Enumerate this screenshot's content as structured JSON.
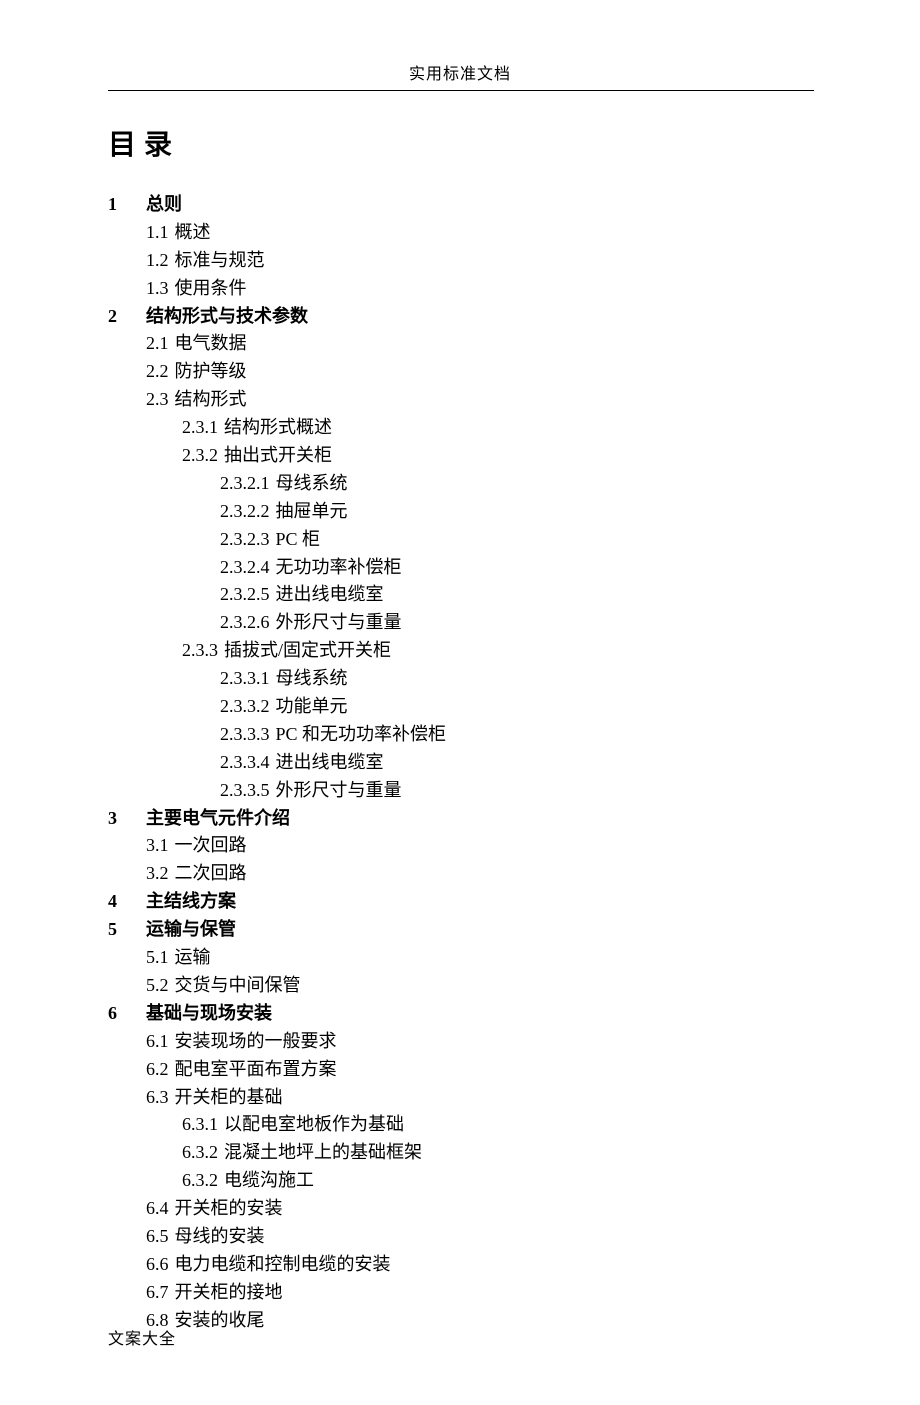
{
  "header": "实用标准文档",
  "footer": "文案大全",
  "title": "目录",
  "toc": [
    {
      "level": 0,
      "bold": true,
      "num": "1",
      "txt": "总则"
    },
    {
      "level": 1,
      "bold": false,
      "num": "1.1",
      "txt": "概述"
    },
    {
      "level": 1,
      "bold": false,
      "num": "1.2",
      "txt": "标准与规范"
    },
    {
      "level": 1,
      "bold": false,
      "num": "1.3",
      "txt": "使用条件"
    },
    {
      "level": 0,
      "bold": true,
      "num": "2",
      "txt": "结构形式与技术参数"
    },
    {
      "level": 1,
      "bold": false,
      "num": "2.1",
      "txt": "电气数据"
    },
    {
      "level": 1,
      "bold": false,
      "num": "2.2",
      "txt": "防护等级"
    },
    {
      "level": 1,
      "bold": false,
      "num": "2.3",
      "txt": "结构形式"
    },
    {
      "level": 2,
      "bold": false,
      "num": "2.3.1",
      "txt": "结构形式概述"
    },
    {
      "level": 2,
      "bold": false,
      "num": "2.3.2",
      "txt": "抽出式开关柜"
    },
    {
      "level": 3,
      "bold": false,
      "num": "2.3.2.1",
      "txt": "母线系统"
    },
    {
      "level": 3,
      "bold": false,
      "num": "2.3.2.2",
      "txt": "抽屉单元"
    },
    {
      "level": 3,
      "bold": false,
      "num": "2.3.2.3",
      "txt": "PC 柜"
    },
    {
      "level": 3,
      "bold": false,
      "num": "2.3.2.4",
      "txt": "无功功率补偿柜"
    },
    {
      "level": 3,
      "bold": false,
      "num": "2.3.2.5",
      "txt": "进出线电缆室"
    },
    {
      "level": 3,
      "bold": false,
      "num": "2.3.2.6",
      "txt": "外形尺寸与重量"
    },
    {
      "level": 2,
      "bold": false,
      "num": "2.3.3",
      "txt": "插拔式/固定式开关柜"
    },
    {
      "level": 3,
      "bold": false,
      "num": "2.3.3.1",
      "txt": "母线系统"
    },
    {
      "level": 3,
      "bold": false,
      "num": "2.3.3.2",
      "txt": "功能单元"
    },
    {
      "level": 3,
      "bold": false,
      "num": "2.3.3.3",
      "txt": "PC 和无功功率补偿柜"
    },
    {
      "level": 3,
      "bold": false,
      "num": "2.3.3.4",
      "txt": "进出线电缆室"
    },
    {
      "level": 3,
      "bold": false,
      "num": "2.3.3.5",
      "txt": "外形尺寸与重量"
    },
    {
      "level": 0,
      "bold": true,
      "num": "3",
      "txt": "主要电气元件介绍"
    },
    {
      "level": 1,
      "bold": false,
      "num": "3.1",
      "txt": "一次回路"
    },
    {
      "level": 1,
      "bold": false,
      "num": "3.2",
      "txt": "二次回路"
    },
    {
      "level": 0,
      "bold": true,
      "num": "4",
      "txt": "主结线方案"
    },
    {
      "level": 0,
      "bold": true,
      "num": "5",
      "txt": "运输与保管"
    },
    {
      "level": 1,
      "bold": false,
      "num": "5.1",
      "txt": "运输"
    },
    {
      "level": 1,
      "bold": false,
      "num": "5.2",
      "txt": "交货与中间保管"
    },
    {
      "level": 0,
      "bold": true,
      "num": "6",
      "txt": "基础与现场安装"
    },
    {
      "level": 1,
      "bold": false,
      "num": "6.1",
      "txt": "安装现场的一般要求"
    },
    {
      "level": 1,
      "bold": false,
      "num": "6.2",
      "txt": "配电室平面布置方案"
    },
    {
      "level": 1,
      "bold": false,
      "num": "6.3",
      "txt": "开关柜的基础"
    },
    {
      "level": 2,
      "bold": false,
      "num": "6.3.1",
      "txt": "以配电室地板作为基础"
    },
    {
      "level": 2,
      "bold": false,
      "num": "6.3.2",
      "txt": "混凝土地坪上的基础框架"
    },
    {
      "level": 2,
      "bold": false,
      "num": "6.3.2",
      "txt": "电缆沟施工"
    },
    {
      "level": 1,
      "bold": false,
      "num": "6.4",
      "txt": "开关柜的安装"
    },
    {
      "level": 1,
      "bold": false,
      "num": "6.5",
      "txt": "母线的安装"
    },
    {
      "level": 1,
      "bold": false,
      "num": "6.6",
      "txt": "电力电缆和控制电缆的安装"
    },
    {
      "level": 1,
      "bold": false,
      "num": "6.7",
      "txt": "开关柜的接地"
    },
    {
      "level": 1,
      "bold": false,
      "num": "6.8",
      "txt": "安装的收尾"
    }
  ]
}
